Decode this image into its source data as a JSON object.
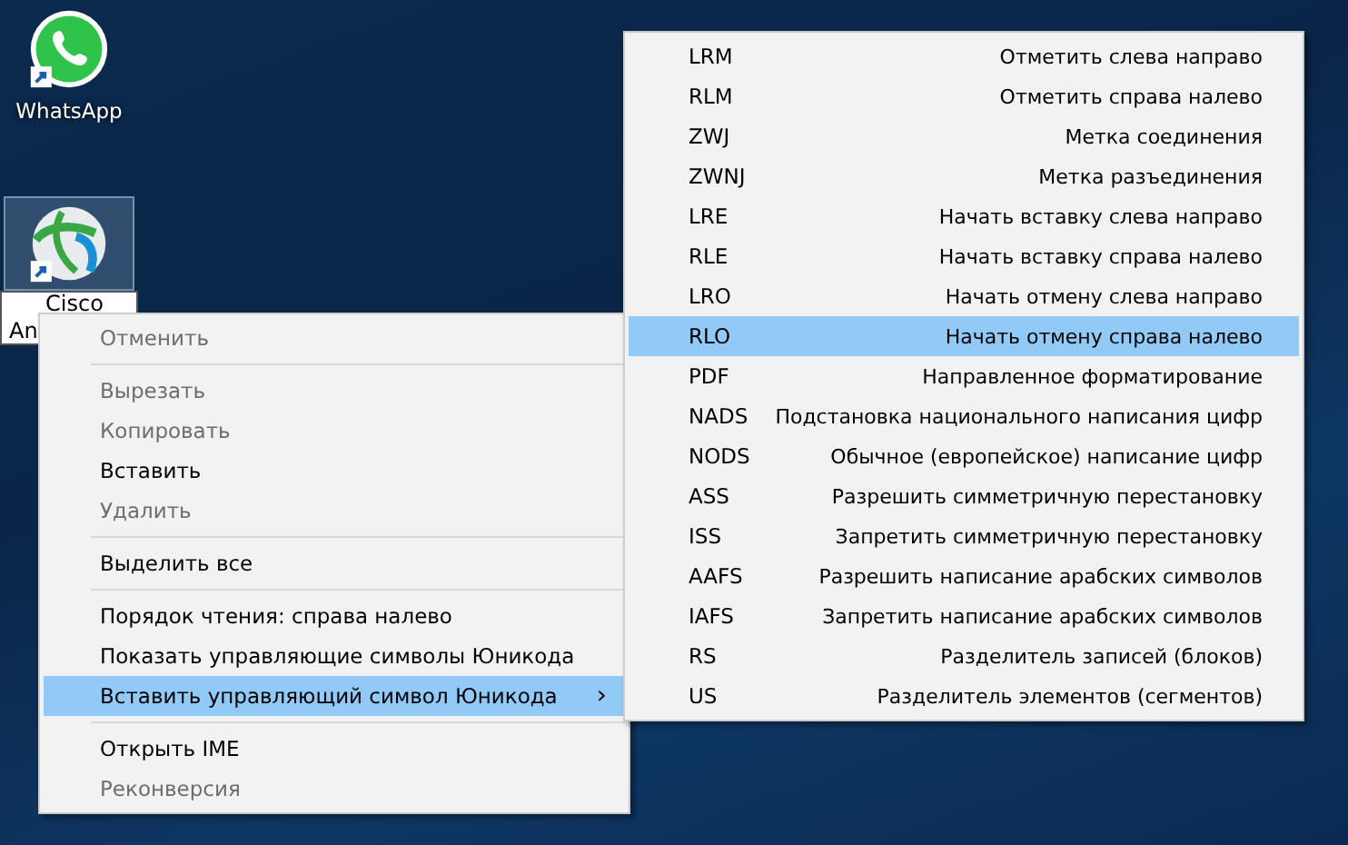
{
  "desktop_icons": [
    {
      "kind": "whatsapp",
      "label": "WhatsApp",
      "selected": false
    },
    {
      "kind": "cisco",
      "label": "Cisco",
      "label_rest": "An",
      "selected": true
    }
  ],
  "context_menu": {
    "items": [
      {
        "kind": "item",
        "label": "Отменить",
        "disabled": true,
        "selected": false
      },
      {
        "kind": "separator"
      },
      {
        "kind": "item",
        "label": "Вырезать",
        "disabled": true,
        "selected": false
      },
      {
        "kind": "item",
        "label": "Копировать",
        "disabled": true,
        "selected": false
      },
      {
        "kind": "item",
        "label": "Вставить",
        "disabled": false,
        "selected": false
      },
      {
        "kind": "item",
        "label": "Удалить",
        "disabled": true,
        "selected": false
      },
      {
        "kind": "separator"
      },
      {
        "kind": "item",
        "label": "Выделить все",
        "disabled": false,
        "selected": false
      },
      {
        "kind": "separator"
      },
      {
        "kind": "item",
        "label": "Порядок чтения: справа налево",
        "disabled": false,
        "selected": false
      },
      {
        "kind": "item",
        "label": "Показать управляющие символы Юникода",
        "disabled": false,
        "selected": false
      },
      {
        "kind": "submenu",
        "label": "Вставить управляющий символ Юникода",
        "disabled": false,
        "selected": true,
        "arrow": "›"
      },
      {
        "kind": "separator"
      },
      {
        "kind": "item",
        "label": "Открыть IME",
        "disabled": false,
        "selected": false
      },
      {
        "kind": "item",
        "label": "Реконверсия",
        "disabled": true,
        "selected": false
      }
    ]
  },
  "submenu": {
    "items": [
      {
        "code": "LRM",
        "description": "Отметить слева направо",
        "selected": false
      },
      {
        "code": "RLM",
        "description": "Отметить справа налево",
        "selected": false
      },
      {
        "code": "ZWJ",
        "description": "Метка соединения",
        "selected": false
      },
      {
        "code": "ZWNJ",
        "description": "Метка разъединения",
        "selected": false
      },
      {
        "code": "LRE",
        "description": "Начать вставку слева направо",
        "selected": false
      },
      {
        "code": "RLE",
        "description": "Начать вставку справа налево",
        "selected": false
      },
      {
        "code": "LRO",
        "description": "Начать отмену слева направо",
        "selected": false
      },
      {
        "code": "RLO",
        "description": "Начать отмену справа налево",
        "selected": true
      },
      {
        "code": "PDF",
        "description": "Направленное форматирование",
        "selected": false
      },
      {
        "code": "NADS",
        "description": "Подстановка национального написания цифр",
        "selected": false
      },
      {
        "code": "NODS",
        "description": "Обычное (европейское) написание цифр",
        "selected": false
      },
      {
        "code": "ASS",
        "description": "Разрешить симметричную перестановку",
        "selected": false
      },
      {
        "code": "ISS",
        "description": "Запретить симметричную перестановку",
        "selected": false
      },
      {
        "code": "AAFS",
        "description": "Разрешить написание арабских символов",
        "selected": false
      },
      {
        "code": "IAFS",
        "description": "Запретить написание арабских символов",
        "selected": false
      },
      {
        "code": "RS",
        "description": "Разделитель записей (блоков)",
        "selected": false
      },
      {
        "code": "US",
        "description": "Разделитель элементов (сегментов)",
        "selected": false
      }
    ]
  }
}
